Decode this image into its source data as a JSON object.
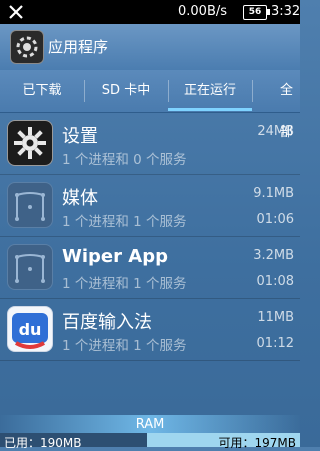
{
  "status_bar": {
    "net_speed": "0.00B/s",
    "battery": "56",
    "time": "3:32"
  },
  "header": {
    "title": "应用程序"
  },
  "tabs": [
    {
      "label": "已下载"
    },
    {
      "label": "SD 卡中"
    },
    {
      "label": "正在运行",
      "selected": true
    },
    {
      "label": "全部"
    }
  ],
  "apps": [
    {
      "name": "设置",
      "processes": "1 个进程和 0 个服务",
      "size": "24MB",
      "time": "",
      "icon": "settings-gear-icon"
    },
    {
      "name": "媒体",
      "processes": "1 个进程和 1 个服务",
      "size": "9.1MB",
      "time": "01:06",
      "icon": "media-robot-icon"
    },
    {
      "name": "Wiper App",
      "processes": "1 个进程和 1 个服务",
      "size": "3.2MB",
      "time": "01:08",
      "icon": "wiper-robot-icon"
    },
    {
      "name": "百度输入法",
      "processes": "1 个进程和 1 个服务",
      "size": "11MB",
      "time": "01:12",
      "icon": "baidu-du-icon"
    }
  ],
  "ram": {
    "label": "RAM",
    "used": "已用：190MB",
    "free": "可用：197MB",
    "used_fraction": 0.49
  },
  "colors": {
    "accent": "#7fd3ff",
    "background": "#4a7bae"
  }
}
